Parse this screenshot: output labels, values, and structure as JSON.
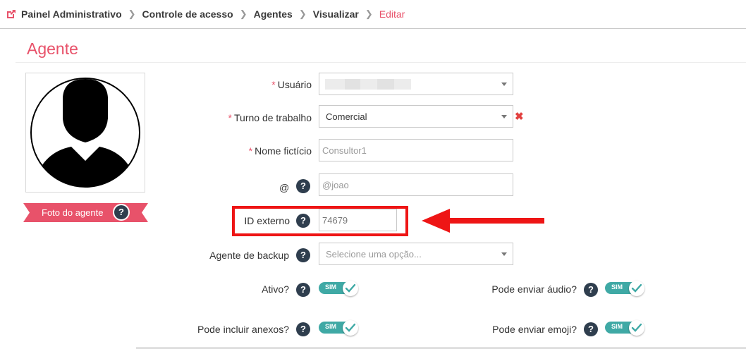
{
  "breadcrumb": {
    "items": [
      "Painel Administrativo",
      "Controle de acesso",
      "Agentes",
      "Visualizar",
      "Editar"
    ]
  },
  "page": {
    "title": "Agente"
  },
  "photo": {
    "label": "Foto do agente",
    "help": "?"
  },
  "form": {
    "usuario": {
      "label": "Usuário",
      "required_mark": "*"
    },
    "turno": {
      "label": "Turno de trabalho",
      "required_mark": "*",
      "value": "Comercial",
      "clear": "✖"
    },
    "nome": {
      "label": "Nome fictício",
      "required_mark": "*",
      "placeholder": "Consultor1"
    },
    "arroba": {
      "label": "@",
      "placeholder": "@joao",
      "help": "?"
    },
    "id_externo": {
      "label": "ID externo",
      "value": "74679",
      "help": "?"
    },
    "backup": {
      "label": "Agente de backup",
      "placeholder": "Selecione uma opção...",
      "help": "?"
    }
  },
  "toggles": [
    {
      "label": "Ativo?",
      "state": "SIM",
      "on": true,
      "help": "?"
    },
    {
      "label": "Pode enviar áudio?",
      "state": "SIM",
      "on": true,
      "help": "?"
    },
    {
      "label": "Pode incluir anexos?",
      "state": "SIM",
      "on": true,
      "help": "?"
    },
    {
      "label": "Pode enviar emoji?",
      "state": "SIM",
      "on": true,
      "help": "?"
    }
  ],
  "colors": {
    "accent": "#e8526a",
    "toggle_on": "#3fa9a5",
    "highlight": "#ee1515",
    "help_bg": "#2f3e4e"
  },
  "icons": {
    "breadcrumb": "external-link-icon",
    "help": "question-circle-icon",
    "check": "check-icon",
    "caret": "chevron-down-icon",
    "arrow": "left-arrow-icon"
  }
}
